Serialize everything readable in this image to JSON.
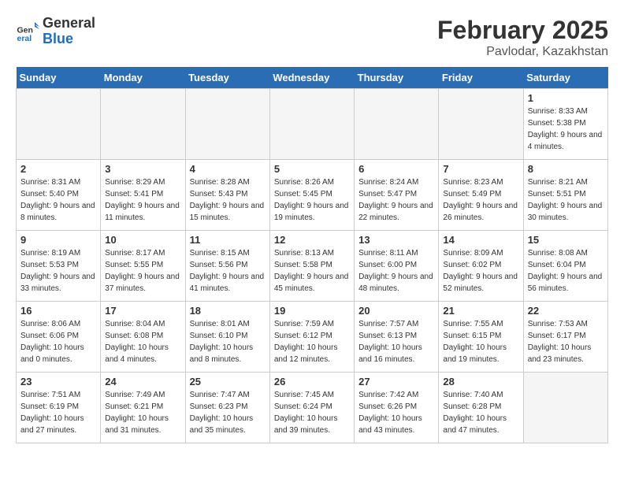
{
  "header": {
    "logo_line1": "General",
    "logo_line2": "Blue",
    "month": "February 2025",
    "location": "Pavlodar, Kazakhstan"
  },
  "weekdays": [
    "Sunday",
    "Monday",
    "Tuesday",
    "Wednesday",
    "Thursday",
    "Friday",
    "Saturday"
  ],
  "weeks": [
    [
      {
        "day": "",
        "info": ""
      },
      {
        "day": "",
        "info": ""
      },
      {
        "day": "",
        "info": ""
      },
      {
        "day": "",
        "info": ""
      },
      {
        "day": "",
        "info": ""
      },
      {
        "day": "",
        "info": ""
      },
      {
        "day": "1",
        "info": "Sunrise: 8:33 AM\nSunset: 5:38 PM\nDaylight: 9 hours and 4 minutes."
      }
    ],
    [
      {
        "day": "2",
        "info": "Sunrise: 8:31 AM\nSunset: 5:40 PM\nDaylight: 9 hours and 8 minutes."
      },
      {
        "day": "3",
        "info": "Sunrise: 8:29 AM\nSunset: 5:41 PM\nDaylight: 9 hours and 11 minutes."
      },
      {
        "day": "4",
        "info": "Sunrise: 8:28 AM\nSunset: 5:43 PM\nDaylight: 9 hours and 15 minutes."
      },
      {
        "day": "5",
        "info": "Sunrise: 8:26 AM\nSunset: 5:45 PM\nDaylight: 9 hours and 19 minutes."
      },
      {
        "day": "6",
        "info": "Sunrise: 8:24 AM\nSunset: 5:47 PM\nDaylight: 9 hours and 22 minutes."
      },
      {
        "day": "7",
        "info": "Sunrise: 8:23 AM\nSunset: 5:49 PM\nDaylight: 9 hours and 26 minutes."
      },
      {
        "day": "8",
        "info": "Sunrise: 8:21 AM\nSunset: 5:51 PM\nDaylight: 9 hours and 30 minutes."
      }
    ],
    [
      {
        "day": "9",
        "info": "Sunrise: 8:19 AM\nSunset: 5:53 PM\nDaylight: 9 hours and 33 minutes."
      },
      {
        "day": "10",
        "info": "Sunrise: 8:17 AM\nSunset: 5:55 PM\nDaylight: 9 hours and 37 minutes."
      },
      {
        "day": "11",
        "info": "Sunrise: 8:15 AM\nSunset: 5:56 PM\nDaylight: 9 hours and 41 minutes."
      },
      {
        "day": "12",
        "info": "Sunrise: 8:13 AM\nSunset: 5:58 PM\nDaylight: 9 hours and 45 minutes."
      },
      {
        "day": "13",
        "info": "Sunrise: 8:11 AM\nSunset: 6:00 PM\nDaylight: 9 hours and 48 minutes."
      },
      {
        "day": "14",
        "info": "Sunrise: 8:09 AM\nSunset: 6:02 PM\nDaylight: 9 hours and 52 minutes."
      },
      {
        "day": "15",
        "info": "Sunrise: 8:08 AM\nSunset: 6:04 PM\nDaylight: 9 hours and 56 minutes."
      }
    ],
    [
      {
        "day": "16",
        "info": "Sunrise: 8:06 AM\nSunset: 6:06 PM\nDaylight: 10 hours and 0 minutes."
      },
      {
        "day": "17",
        "info": "Sunrise: 8:04 AM\nSunset: 6:08 PM\nDaylight: 10 hours and 4 minutes."
      },
      {
        "day": "18",
        "info": "Sunrise: 8:01 AM\nSunset: 6:10 PM\nDaylight: 10 hours and 8 minutes."
      },
      {
        "day": "19",
        "info": "Sunrise: 7:59 AM\nSunset: 6:12 PM\nDaylight: 10 hours and 12 minutes."
      },
      {
        "day": "20",
        "info": "Sunrise: 7:57 AM\nSunset: 6:13 PM\nDaylight: 10 hours and 16 minutes."
      },
      {
        "day": "21",
        "info": "Sunrise: 7:55 AM\nSunset: 6:15 PM\nDaylight: 10 hours and 19 minutes."
      },
      {
        "day": "22",
        "info": "Sunrise: 7:53 AM\nSunset: 6:17 PM\nDaylight: 10 hours and 23 minutes."
      }
    ],
    [
      {
        "day": "23",
        "info": "Sunrise: 7:51 AM\nSunset: 6:19 PM\nDaylight: 10 hours and 27 minutes."
      },
      {
        "day": "24",
        "info": "Sunrise: 7:49 AM\nSunset: 6:21 PM\nDaylight: 10 hours and 31 minutes."
      },
      {
        "day": "25",
        "info": "Sunrise: 7:47 AM\nSunset: 6:23 PM\nDaylight: 10 hours and 35 minutes."
      },
      {
        "day": "26",
        "info": "Sunrise: 7:45 AM\nSunset: 6:24 PM\nDaylight: 10 hours and 39 minutes."
      },
      {
        "day": "27",
        "info": "Sunrise: 7:42 AM\nSunset: 6:26 PM\nDaylight: 10 hours and 43 minutes."
      },
      {
        "day": "28",
        "info": "Sunrise: 7:40 AM\nSunset: 6:28 PM\nDaylight: 10 hours and 47 minutes."
      },
      {
        "day": "",
        "info": ""
      }
    ]
  ]
}
